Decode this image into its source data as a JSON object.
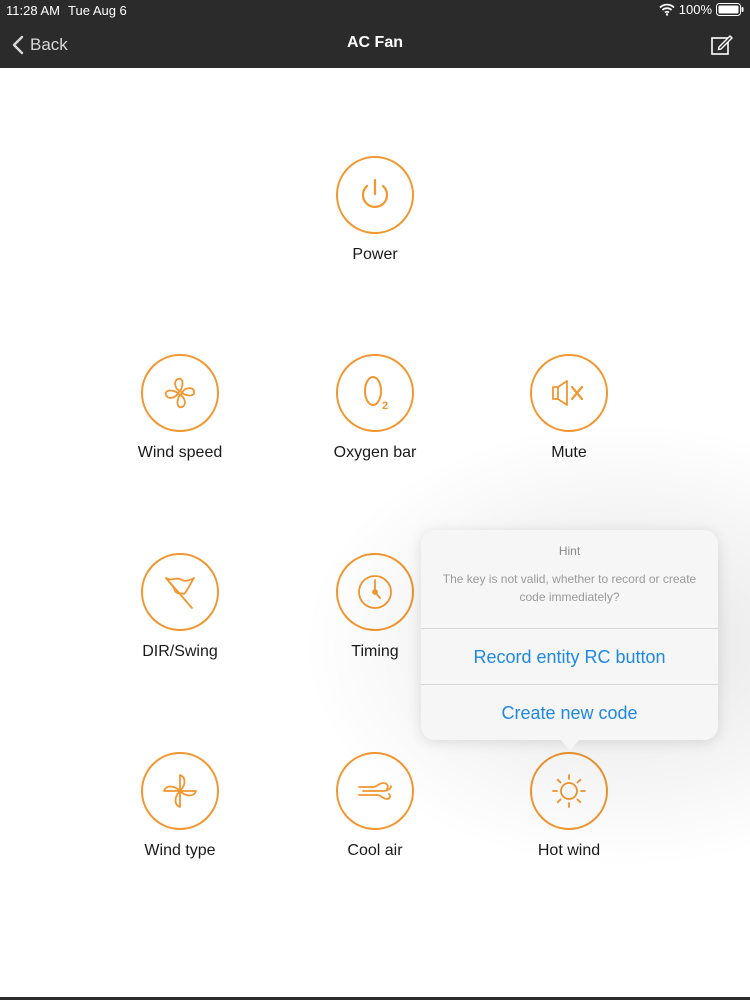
{
  "status": {
    "time": "11:28 AM",
    "date": "Tue Aug 6",
    "battery": "100%"
  },
  "nav": {
    "back_label": "Back",
    "title": "AC Fan"
  },
  "accent_color": "#f2962f",
  "buttons": {
    "power": {
      "label": "Power",
      "icon": "power-icon"
    },
    "wind_speed": {
      "label": "Wind speed",
      "icon": "fan-icon"
    },
    "oxygen_bar": {
      "label": "Oxygen bar",
      "icon": "oxygen-icon"
    },
    "mute": {
      "label": "Mute",
      "icon": "mute-icon"
    },
    "dir_swing": {
      "label": "DIR/Swing",
      "icon": "flag-icon"
    },
    "timing": {
      "label": "Timing",
      "icon": "clock-icon"
    },
    "wind_type": {
      "label": "Wind type",
      "icon": "pinwheel-icon"
    },
    "cool_air": {
      "label": "Cool air",
      "icon": "wind-icon"
    },
    "hot_wind": {
      "label": "Hot wind",
      "icon": "sun-icon"
    }
  },
  "hint": {
    "title": "Hint",
    "message": "The key is not valid, whether to record or create code immediately?",
    "actions": [
      "Record entity RC button",
      "Create new code"
    ]
  }
}
